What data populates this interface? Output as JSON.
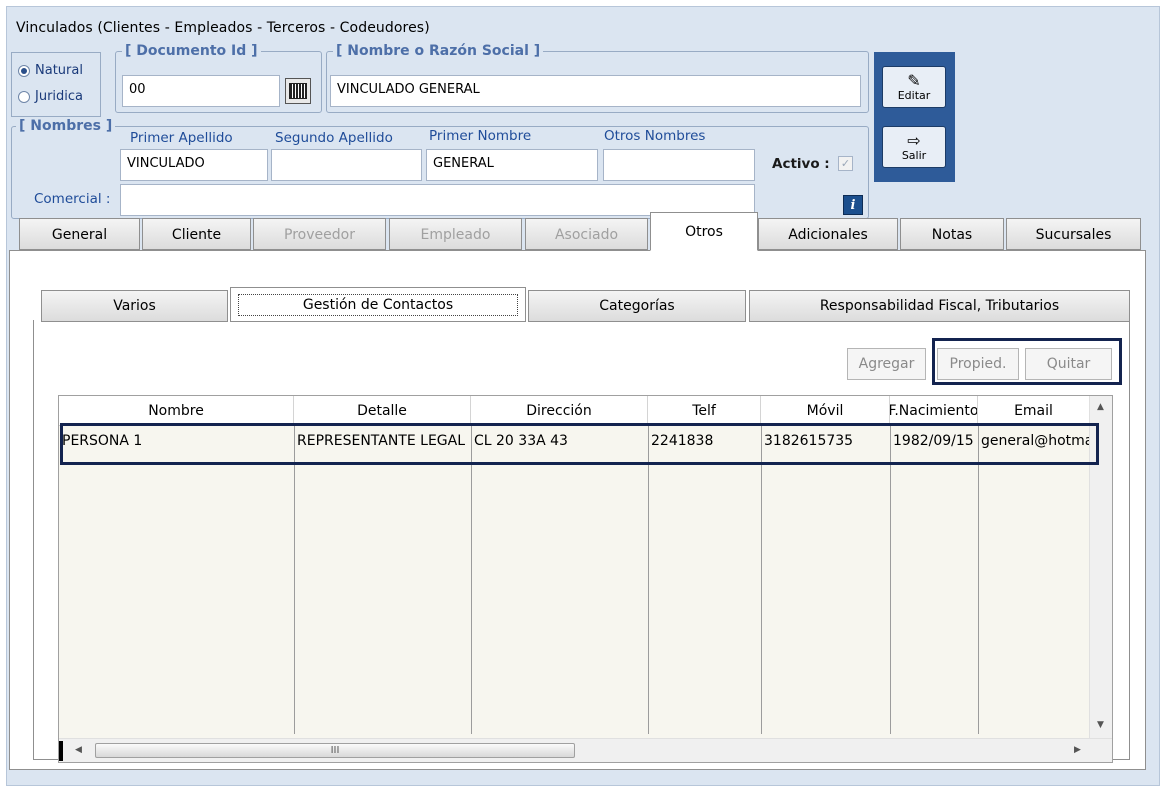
{
  "window": {
    "title": "Vinculados   (Clientes - Empleados - Terceros - Codeudores)"
  },
  "persona_tipo": {
    "options": [
      "Natural",
      "Juridica"
    ],
    "selected": "Natural"
  },
  "documento": {
    "legend": "[ Documento Id ]",
    "value": "00"
  },
  "razon_social": {
    "legend": "[ Nombre o Razón Social ]",
    "value": "VINCULADO GENERAL"
  },
  "nombres": {
    "legend": "[ Nombres ]",
    "primer_apellido_label": "Primer Apellido",
    "primer_apellido": "VINCULADO",
    "segundo_apellido_label": "Segundo Apellido",
    "segundo_apellido": "",
    "primer_nombre_label": "Primer Nombre",
    "primer_nombre": "GENERAL",
    "otros_nombres_label": "Otros Nombres",
    "otros_nombres": "",
    "comercial_label": "Comercial :",
    "comercial": ""
  },
  "activo": {
    "label": "Activo :",
    "checked": true
  },
  "side_buttons": {
    "editar": "Editar",
    "salir": "Salir"
  },
  "tabs": [
    {
      "label": "General",
      "state": "normal"
    },
    {
      "label": "Cliente",
      "state": "normal"
    },
    {
      "label": "Proveedor",
      "state": "disabled"
    },
    {
      "label": "Empleado",
      "state": "disabled"
    },
    {
      "label": "Asociado",
      "state": "disabled"
    },
    {
      "label": "Otros",
      "state": "active"
    },
    {
      "label": "Adicionales",
      "state": "normal"
    },
    {
      "label": "Notas",
      "state": "normal"
    },
    {
      "label": "Sucursales",
      "state": "normal"
    }
  ],
  "subtabs": [
    {
      "label": "Varios",
      "state": "normal"
    },
    {
      "label": "Gestión de Contactos",
      "state": "active"
    },
    {
      "label": "Categorías",
      "state": "normal"
    },
    {
      "label": "Responsabilidad Fiscal, Tributarios",
      "state": "normal"
    }
  ],
  "actions": {
    "agregar": "Agregar",
    "propied": "Propied.",
    "quitar": "Quitar"
  },
  "grid": {
    "columns": [
      "Nombre",
      "Detalle",
      "Dirección",
      "Telf",
      "Móvil",
      "F.Nacimiento",
      "Email"
    ],
    "rows": [
      [
        "PERSONA 1",
        "REPRESENTANTE LEGAL",
        "CL 20 33A 43",
        "2241838",
        "3182615735",
        "1982/09/15",
        "general@hotma"
      ]
    ],
    "hscroll_grip": "III"
  },
  "icons": {
    "barcode": "barcode-icon",
    "editar": "edit-form-icon",
    "salir": "exit-door-icon",
    "info": "info-icon",
    "check": "checkmark-icon"
  },
  "colors": {
    "window_bg": "#dbe5f1",
    "legend": "#4d6fa8",
    "label": "#1f4c99",
    "side_panel": "#2e5b99",
    "highlight": "#13234f"
  }
}
